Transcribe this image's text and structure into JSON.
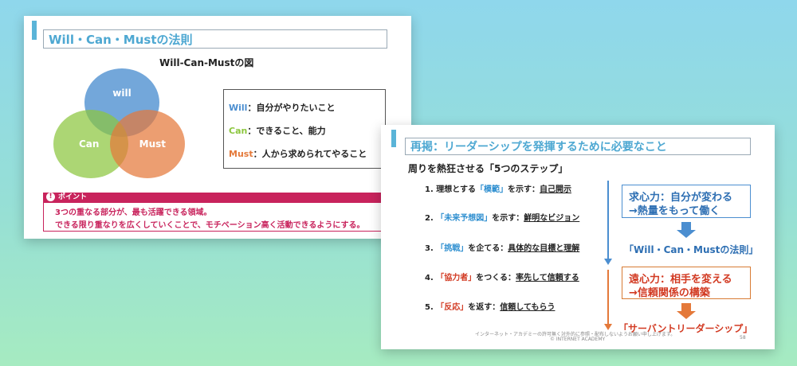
{
  "slide1": {
    "title": "Will・Can・Mustの法則",
    "venn_title": "Will-Can-Mustの図",
    "circles": {
      "will": "will",
      "can": "Can",
      "must": "Must"
    },
    "definitions": [
      {
        "key": "Will",
        "text": "：自分がやりたいこと",
        "color": "#4b8ed0"
      },
      {
        "key": "Can",
        "text": "：できること、能力",
        "color": "#8cc63e"
      },
      {
        "key": "Must",
        "text": "：人から求められてやること",
        "color": "#e4793a"
      }
    ],
    "point": {
      "label": "ポイント",
      "lines": [
        "3つの重なる部分が、最も活躍できる領域。",
        "できる限り重なりを広くしていくことで、モチベーション高く活動できるようにする。"
      ]
    }
  },
  "slide2": {
    "title": "再掲：リーダーシップを発揮するために必要なこと",
    "subtitle": "周りを熱狂させる「5つのステップ」",
    "steps": [
      {
        "num": "1. 理想とする",
        "keyword": "「模範」",
        "verb": "を示す：",
        "detail": "自己開示"
      },
      {
        "num": "2. ",
        "keyword": "「未来予想図」",
        "verb": "を示す：",
        "detail": "鮮明なビジョン"
      },
      {
        "num": "3. ",
        "keyword": "「挑戦」",
        "verb": "を企てる：",
        "detail": "具体的な目標と理解"
      },
      {
        "num": "4. ",
        "keyword": "「協力者」",
        "verb": "をつくる：",
        "detail": "率先して信頼する"
      },
      {
        "num": "5. ",
        "keyword": "「反応」",
        "verb": "を返す：",
        "detail": "信頼してもらう"
      }
    ],
    "blue_box": {
      "line1": "求心力：自分が変わる",
      "line2": "→熱量をもって働く"
    },
    "blue_result": "「Will・Can・Mustの法則」",
    "red_box": {
      "line1": "遠心力：相手を変える",
      "line2": "→信頼関係の構築"
    },
    "red_result": "「サーバントリーダーシップ」",
    "footer_note": "インターネット・アカデミーの許可無く対外的に参照・配布しないようお願い申し上げます。",
    "footer_copyright": "© INTERNET ACADEMY",
    "page_number": "58"
  },
  "colors": {
    "accent": "#5ab4d8",
    "will": "#4b8ed0",
    "can": "#8cc63e",
    "must": "#e4793a",
    "point": "#c8235c",
    "blue_text": "#2e6fb3",
    "red_text": "#d23a22"
  }
}
